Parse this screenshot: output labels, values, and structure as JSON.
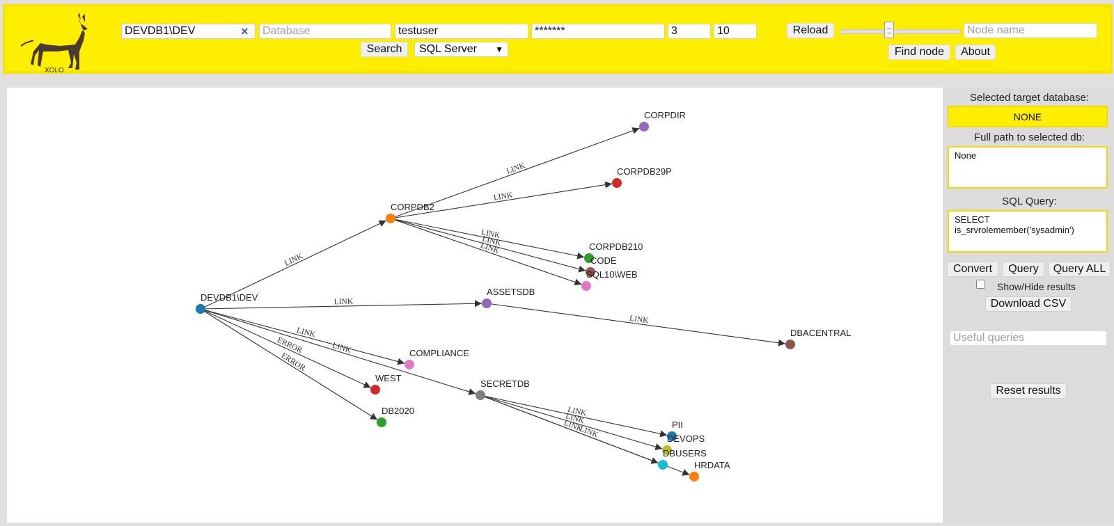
{
  "toolbar": {
    "logo_text": "XOLO",
    "server": {
      "value": "DEVDB1\\DEV"
    },
    "database": {
      "placeholder": "Database"
    },
    "username": {
      "value": "testuser"
    },
    "password": {
      "value": "*******"
    },
    "depth": {
      "value": "3"
    },
    "limit": {
      "value": "10"
    },
    "search_label": "Search",
    "db_type": {
      "selected": "SQL Server",
      "arrow": "▼"
    },
    "reload_label": "Reload",
    "node_name": {
      "placeholder": "Node name"
    },
    "find_node_label": "Find node",
    "about_label": "About"
  },
  "graph": {
    "nodes": [
      {
        "id": "devdb1",
        "label": "DEVDB1\\DEV",
        "color": "#1f77b4"
      },
      {
        "id": "corpdb2",
        "label": "CORPDB2",
        "color": "#ff7f0e"
      },
      {
        "id": "corpdir",
        "label": "CORPDIR",
        "color": "#9467bd"
      },
      {
        "id": "corpdb29p",
        "label": "CORPDB29P",
        "color": "#d62728"
      },
      {
        "id": "corpdb210",
        "label": "CORPDB210",
        "color": "#2ca02c"
      },
      {
        "id": "code",
        "label": "CODE",
        "color": "#8c564b"
      },
      {
        "id": "sql10web",
        "label": "SQL10\\WEB",
        "color": "#e377c2"
      },
      {
        "id": "assetsdb",
        "label": "ASSETSDB",
        "color": "#9467bd"
      },
      {
        "id": "dbacentral",
        "label": "DBACENTRAL",
        "color": "#8c564b"
      },
      {
        "id": "compliance",
        "label": "COMPLIANCE",
        "color": "#e377c2"
      },
      {
        "id": "west",
        "label": "WEST",
        "color": "#d62728"
      },
      {
        "id": "db2020",
        "label": "DB2020",
        "color": "#2ca02c"
      },
      {
        "id": "secretdb",
        "label": "SECRETDB",
        "color": "#7f7f7f"
      },
      {
        "id": "pii",
        "label": "PII",
        "color": "#1f77b4"
      },
      {
        "id": "devops",
        "label": "DEVOPS",
        "color": "#bcbd22"
      },
      {
        "id": "dbusers",
        "label": "DBUSERS",
        "color": "#17becf"
      },
      {
        "id": "hrdata",
        "label": "HRDATA",
        "color": "#ff7f0e"
      }
    ],
    "edges": [
      {
        "source": "devdb1",
        "target": "corpdb2",
        "label": "LINK"
      },
      {
        "source": "corpdb2",
        "target": "corpdir",
        "label": "LINK"
      },
      {
        "source": "corpdb2",
        "target": "corpdb29p",
        "label": "LINK"
      },
      {
        "source": "corpdb2",
        "target": "corpdb210",
        "label": "LINK"
      },
      {
        "source": "corpdb2",
        "target": "code",
        "label": "LINK"
      },
      {
        "source": "corpdb2",
        "target": "sql10web",
        "label": "LINK"
      },
      {
        "source": "devdb1",
        "target": "assetsdb",
        "label": "LINK"
      },
      {
        "source": "assetsdb",
        "target": "dbacentral",
        "label": "LINK"
      },
      {
        "source": "devdb1",
        "target": "compliance",
        "label": "LINK"
      },
      {
        "source": "devdb1",
        "target": "secretdb",
        "label": "LINK"
      },
      {
        "source": "devdb1",
        "target": "west",
        "label": "ERROR"
      },
      {
        "source": "devdb1",
        "target": "db2020",
        "label": "ERROR"
      },
      {
        "source": "secretdb",
        "target": "pii",
        "label": "LINK"
      },
      {
        "source": "secretdb",
        "target": "devops",
        "label": "LINK"
      },
      {
        "source": "secretdb",
        "target": "dbusers",
        "label": "LINK"
      },
      {
        "source": "secretdb",
        "target": "hrdata",
        "label": "LINK"
      }
    ]
  },
  "side": {
    "target_label": "Selected target database:",
    "target_value": "NONE",
    "fullpath_label": "Full path to selected db:",
    "fullpath_value": "None",
    "sql_label": "SQL Query:",
    "sql_value": "SELECT\nis_srvrolemember('sysadmin')",
    "convert_label": "Convert",
    "query_label": "Query",
    "query_all_label": "Query ALL",
    "show_hide_label": "Show/Hide results",
    "download_label": "Download CSV",
    "useful_placeholder": "Useful queries",
    "reset_label": "Reset results"
  },
  "colors": {
    "toolbar_bg": "#ffee00",
    "accent_border": "#f2da00"
  }
}
